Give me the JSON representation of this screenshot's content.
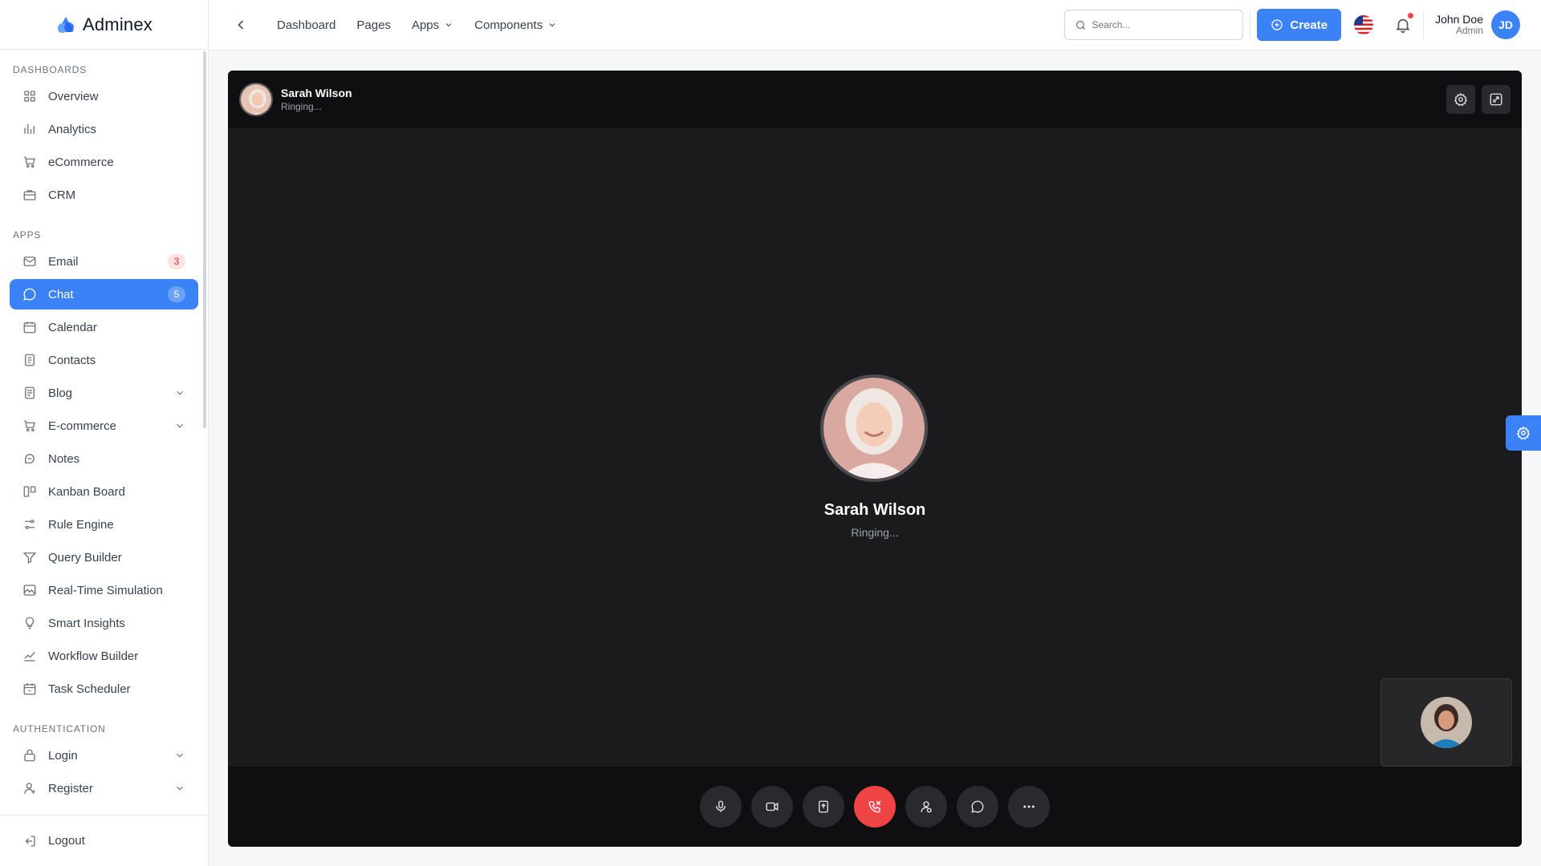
{
  "app": {
    "name": "Adminex"
  },
  "sidebar": {
    "sections": [
      {
        "title": "Dashboards",
        "items": [
          {
            "label": "Overview",
            "icon": "grid-icon"
          },
          {
            "label": "Analytics",
            "icon": "bar-chart-icon"
          },
          {
            "label": "eCommerce",
            "icon": "cart-icon"
          },
          {
            "label": "CRM",
            "icon": "briefcase-icon"
          }
        ]
      },
      {
        "title": "Apps",
        "items": [
          {
            "label": "Email",
            "icon": "mail-icon",
            "badge": "3",
            "badge_style": "red"
          },
          {
            "label": "Chat",
            "icon": "chat-icon",
            "badge": "5",
            "badge_style": "blue",
            "active": true
          },
          {
            "label": "Calendar",
            "icon": "calendar-icon"
          },
          {
            "label": "Contacts",
            "icon": "contacts-icon"
          },
          {
            "label": "Blog",
            "icon": "document-icon",
            "expandable": true
          },
          {
            "label": "E-commerce",
            "icon": "cart-icon",
            "expandable": true
          },
          {
            "label": "Notes",
            "icon": "notes-icon"
          },
          {
            "label": "Kanban Board",
            "icon": "kanban-icon"
          },
          {
            "label": "Rule Engine",
            "icon": "sliders-icon"
          },
          {
            "label": "Query Builder",
            "icon": "filter-icon"
          },
          {
            "label": "Real-Time Simulation",
            "icon": "image-icon"
          },
          {
            "label": "Smart Insights",
            "icon": "lightbulb-icon"
          },
          {
            "label": "Workflow Builder",
            "icon": "line-chart-icon"
          },
          {
            "label": "Task Scheduler",
            "icon": "calendar-clock-icon"
          }
        ]
      },
      {
        "title": "Authentication",
        "items": [
          {
            "label": "Login",
            "icon": "lock-icon",
            "expandable": true
          },
          {
            "label": "Register",
            "icon": "user-add-icon",
            "expandable": true
          }
        ]
      }
    ],
    "logout_label": "Logout"
  },
  "header": {
    "nav": [
      {
        "label": "Dashboard",
        "dropdown": false
      },
      {
        "label": "Pages",
        "dropdown": false
      },
      {
        "label": "Apps",
        "dropdown": true
      },
      {
        "label": "Components",
        "dropdown": true
      }
    ],
    "search_placeholder": "Search...",
    "create_label": "Create",
    "user": {
      "name": "John Doe",
      "role": "Admin",
      "initials": "JD"
    }
  },
  "call": {
    "contact_name": "Sarah Wilson",
    "status": "Ringing...",
    "controls": [
      "mic-icon",
      "video-icon",
      "screen-share-icon",
      "end-call-icon",
      "add-user-icon",
      "chat-icon",
      "more-icon"
    ]
  },
  "colors": {
    "accent": "#3b82f6",
    "danger": "#ef4444",
    "call_bg": "#1b1b1e",
    "call_bar": "#0f0f11"
  }
}
